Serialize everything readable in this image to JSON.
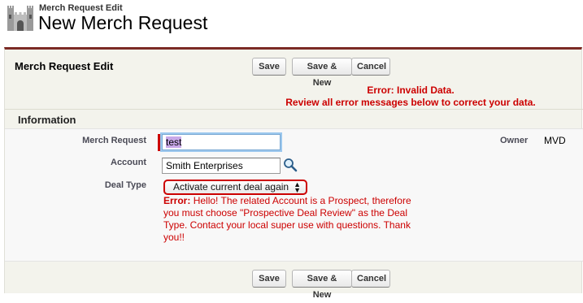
{
  "header": {
    "subtitle": "Merch Request Edit",
    "title": "New Merch Request"
  },
  "panel": {
    "title": "Merch Request Edit",
    "buttons": {
      "save": "Save",
      "save_new": "Save & New",
      "cancel": "Cancel"
    }
  },
  "error_summary": {
    "line1": "Error: Invalid Data.",
    "line2": "Review all error messages below to correct your data."
  },
  "section": {
    "title": "Information"
  },
  "form": {
    "merch_request": {
      "label": "Merch Request",
      "value": "test"
    },
    "account": {
      "label": "Account",
      "value": "Smith Enterprises"
    },
    "deal_type": {
      "label": "Deal Type",
      "value": "Activate current deal again",
      "error_prefix": "Error:",
      "error_message": "Hello! The related Account is a Prospect, therefore you must choose \"Prospective Deal Review\" as the Deal Type. Contact your local super use with questions. Thank you!!"
    },
    "owner": {
      "label": "Owner",
      "value": "MVD"
    }
  },
  "footer": {
    "buttons": {
      "save": "Save",
      "save_new": "Save & New",
      "cancel": "Cancel"
    }
  },
  "colors": {
    "accent_border": "#7b2a25",
    "error": "#cc0000",
    "panel_bg": "#f3f3ec"
  },
  "icons": {
    "logo": "castle-icon",
    "lookup": "lookup-magnifier-icon",
    "select": "up-down-arrows-icon"
  }
}
